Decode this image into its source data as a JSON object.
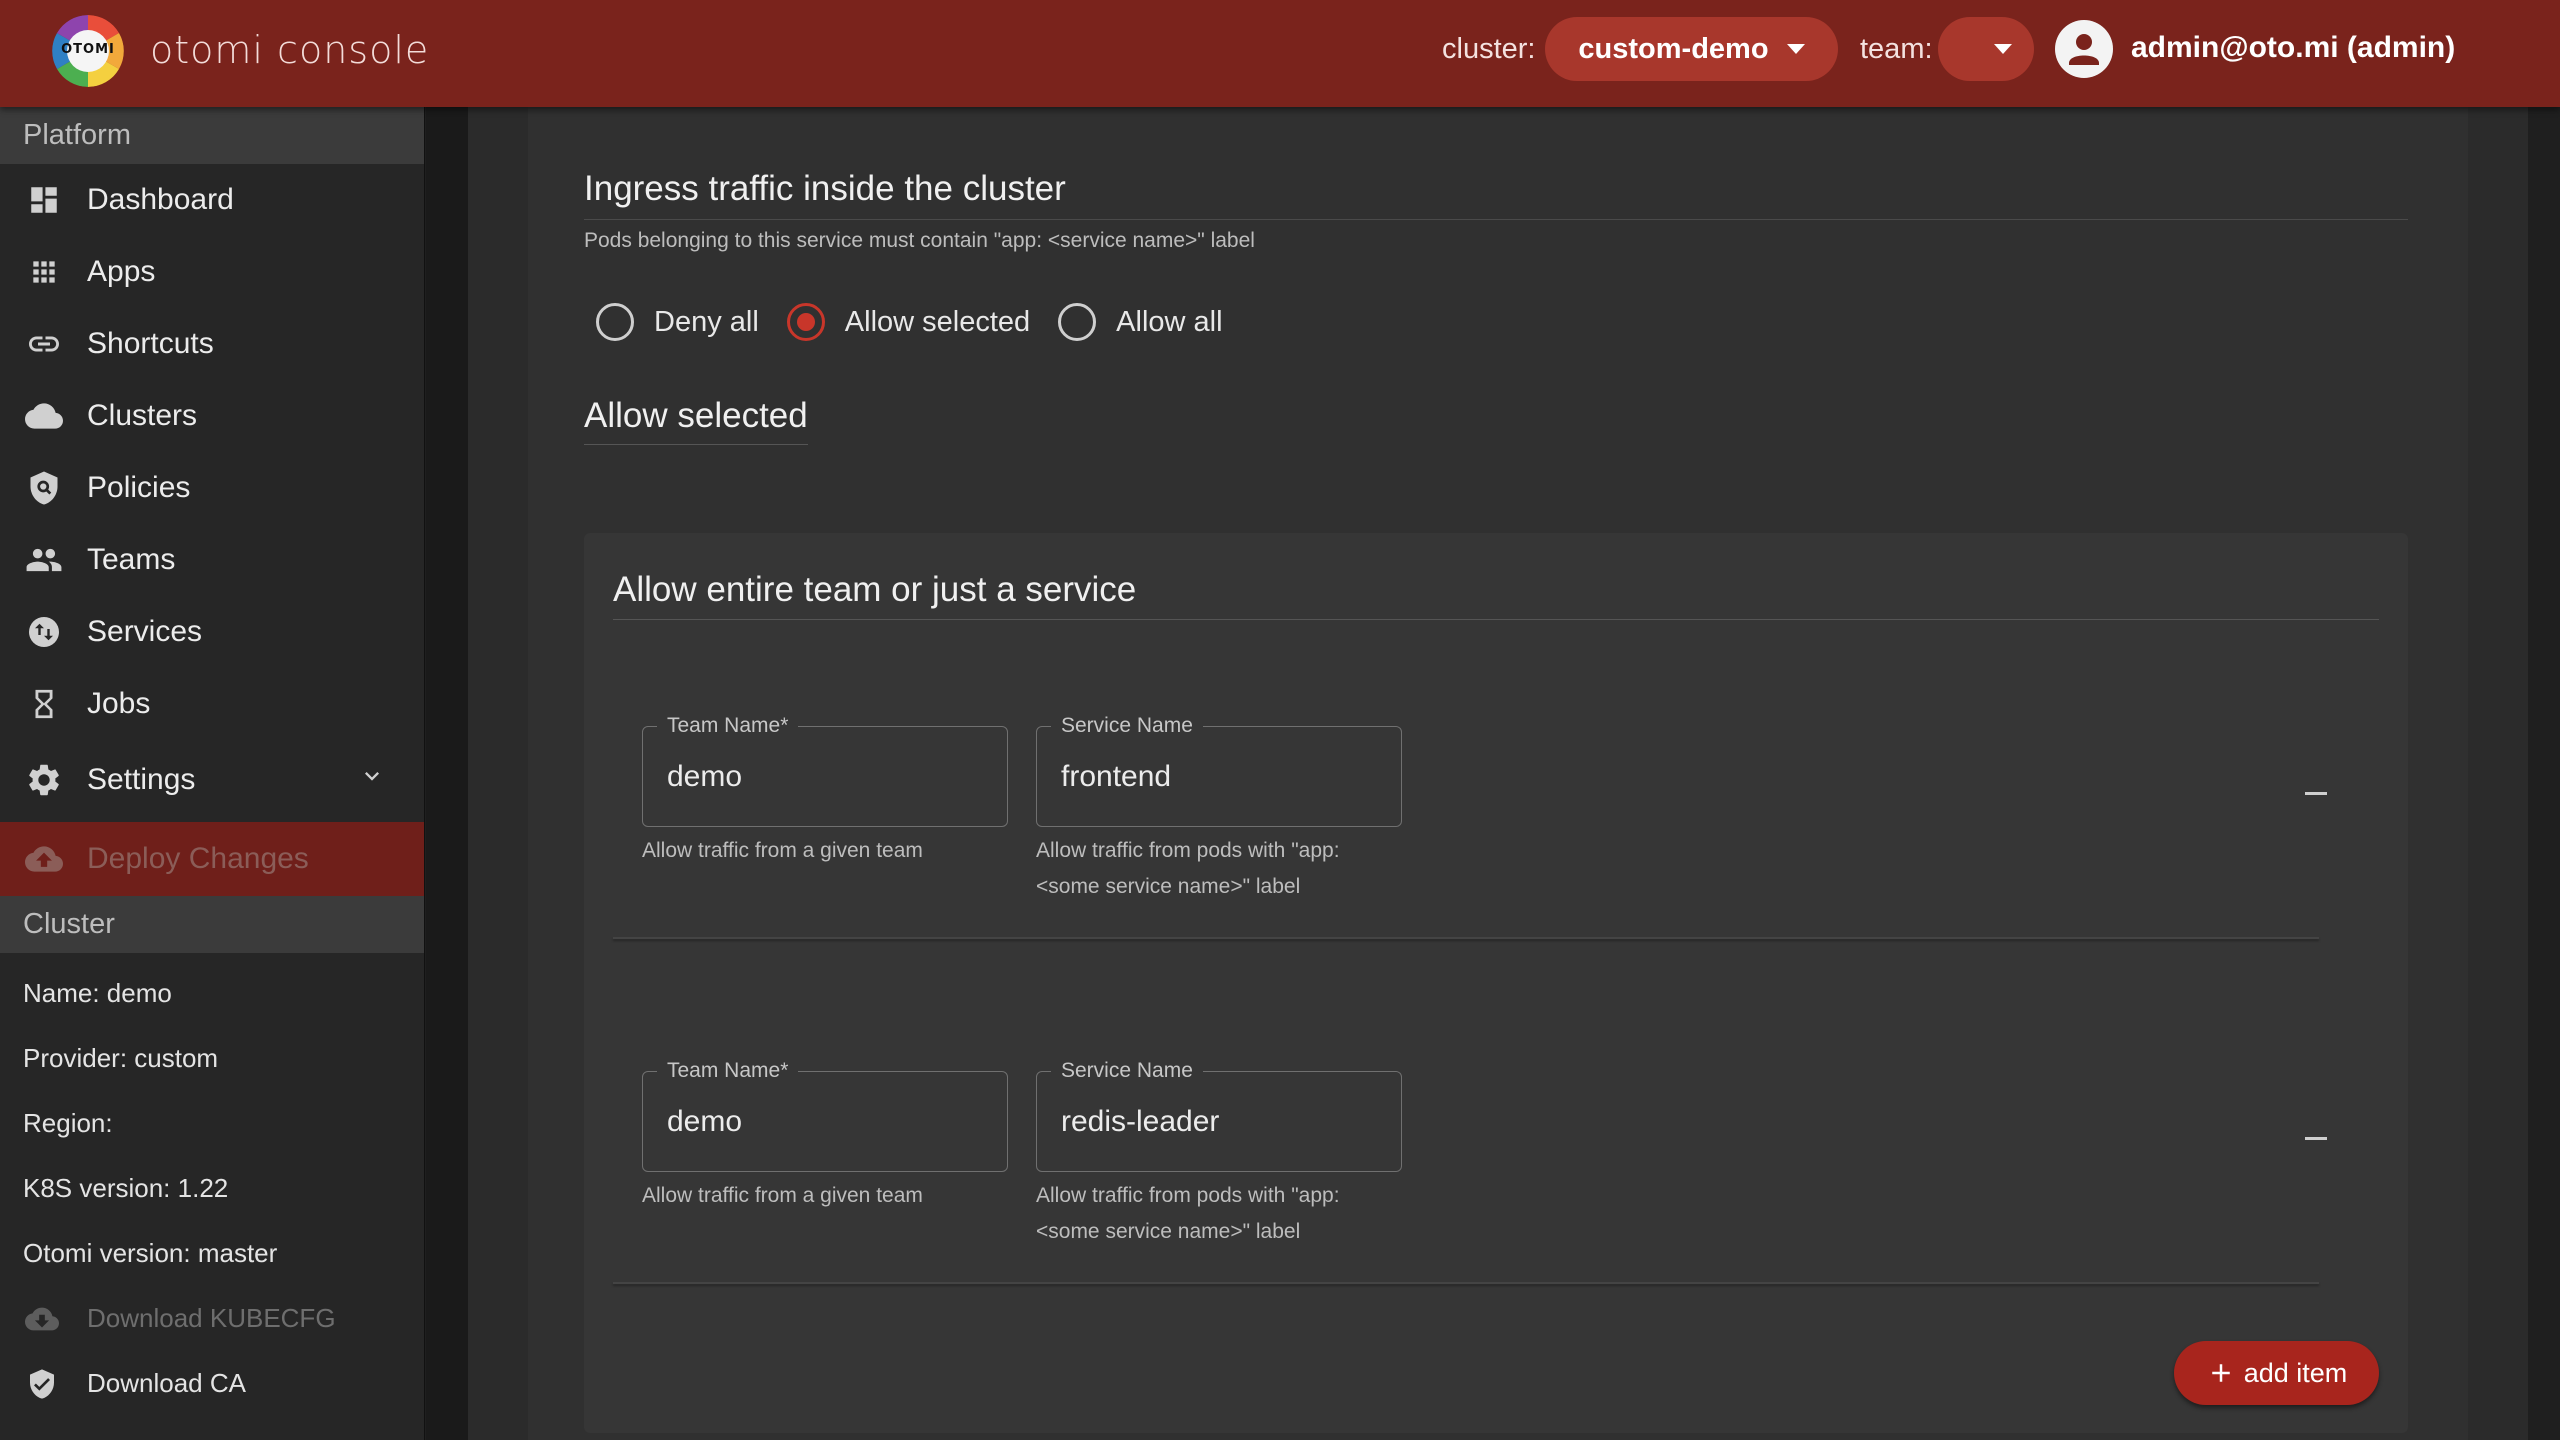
{
  "header": {
    "logo_text": "OTOMI",
    "app_title": "otomi console",
    "cluster_label": "cluster:",
    "cluster_value": "custom-demo",
    "team_label": "team:",
    "team_value": "",
    "user": "admin@oto.mi (admin)"
  },
  "sidebar": {
    "platform_heading": "Platform",
    "items": [
      {
        "label": "Dashboard",
        "icon": "dashboard-icon"
      },
      {
        "label": "Apps",
        "icon": "apps-grid-icon"
      },
      {
        "label": "Shortcuts",
        "icon": "link-icon"
      },
      {
        "label": "Clusters",
        "icon": "cloud-icon"
      },
      {
        "label": "Policies",
        "icon": "policy-shield-icon"
      },
      {
        "label": "Teams",
        "icon": "people-icon"
      },
      {
        "label": "Services",
        "icon": "swap-circle-icon"
      },
      {
        "label": "Jobs",
        "icon": "hourglass-icon"
      },
      {
        "label": "Settings",
        "icon": "gear-icon"
      }
    ],
    "deploy_label": "Deploy Changes",
    "cluster_heading": "Cluster",
    "cluster_info": {
      "name": "Name: demo",
      "provider": "Provider: custom",
      "region": "Region:",
      "k8s": "K8S version: 1.22",
      "otomi": "Otomi version: master"
    },
    "download_kubecfg": "Download KUBECFG",
    "download_ca": "Download CA"
  },
  "main": {
    "section_title": "Ingress traffic inside the cluster",
    "section_desc": "Pods belonging to this service must contain \"app: <service name>\" label",
    "radio_options": [
      "Deny all",
      "Allow selected",
      "Allow all"
    ],
    "radio_selected": "Allow selected",
    "subsection_title": "Allow selected",
    "card_title": "Allow entire team or just a service",
    "team_field_label": "Team Name",
    "required_mark": "*",
    "service_field_label": "Service Name",
    "team_helper": "Allow traffic from a given team",
    "service_helper_1": "Allow traffic from pods with \"app:",
    "service_helper_2": "<some service name>\" label",
    "rows": [
      {
        "team": "demo",
        "service": "frontend"
      },
      {
        "team": "demo",
        "service": "redis-leader"
      }
    ],
    "add_item_label": "add item"
  },
  "colors": {
    "brand": "#7a231c",
    "accent": "#c8362a",
    "sidebar_bg": "#262626",
    "main_bg": "#303030"
  }
}
